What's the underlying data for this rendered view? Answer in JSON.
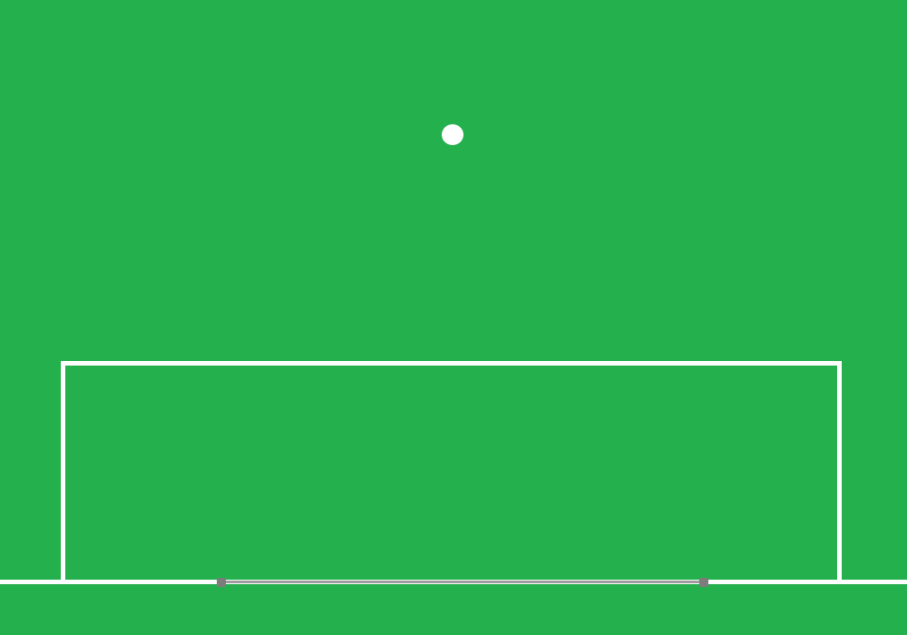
{
  "scene": {
    "type": "soccer-goal-top-down",
    "colors": {
      "pitch": "#24b04d",
      "lines": "#ffffff",
      "goal_bar": "#9d9d9d",
      "goal_posts": "#7c7c7c",
      "ball": "#ffffff"
    },
    "elements": [
      "pitch",
      "penalty-box",
      "goal-line",
      "goal",
      "ball"
    ]
  }
}
